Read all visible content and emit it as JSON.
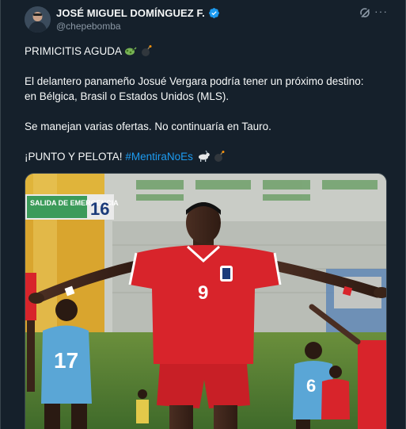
{
  "author": {
    "name": "JOSÉ MIGUEL DOMÍNGUEZ F.",
    "handle": "@chepebomba"
  },
  "tweet": {
    "line1": "PRIMICITIS AGUDA",
    "line2": "El delantero panameño Josué Vergara podría tener un próximo destino:",
    "line3": "en Bélgica, Brasil o Estados Unidos (MLS).",
    "line4": "Se manejan varias ofertas. No continuaría en Tauro.",
    "line5": "¡PUNTO Y PELOTA!",
    "hashtag": "#MentiraNoEs"
  },
  "media": {
    "sign_text": "SALIDA DE EMERGENCIA",
    "sign_number": "16",
    "player_number": "9",
    "left_player_number": "17",
    "right_player_number": "6"
  },
  "colors": {
    "background": "#15202b",
    "text": "#f7f9f9",
    "secondary": "#8b98a5",
    "link": "#1d9bf0",
    "verified": "#1d9bf0",
    "jersey_red": "#d8242b"
  },
  "icons": [
    "verified-badge-icon",
    "grok-icon",
    "more-icon",
    "green-virus-emoji",
    "bomb-emoji",
    "goat-emoji"
  ]
}
